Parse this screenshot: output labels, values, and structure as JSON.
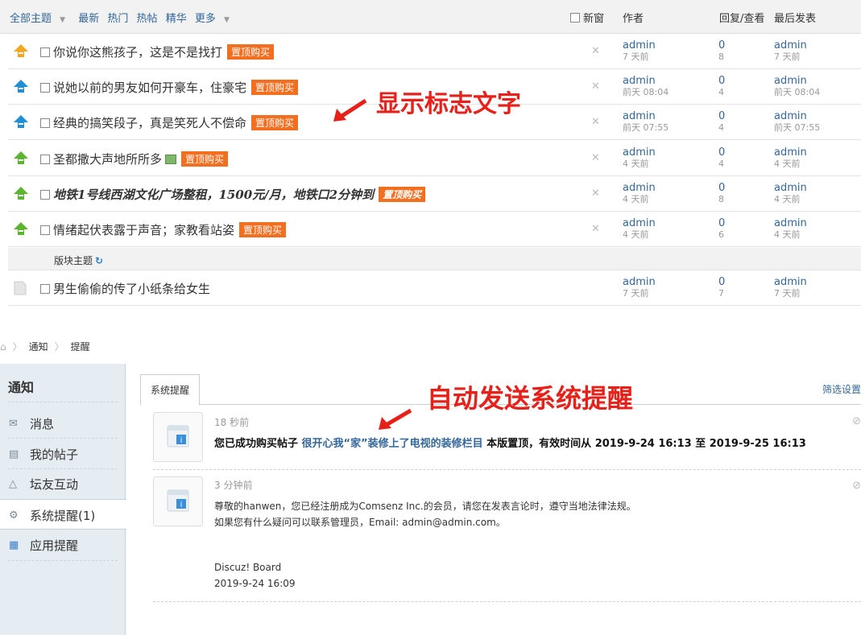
{
  "thread_header": {
    "tabs": [
      "全部主题",
      "最新",
      "热门",
      "热帖",
      "精华",
      "更多"
    ],
    "new_window": "新窗",
    "col_author": "作者",
    "col_reply_view": "回复/查看",
    "col_last_post": "最后发表"
  },
  "threads": [
    {
      "title": "你说你这熊孩子，这是不是找打",
      "badge": "置顶购买",
      "author": "admin",
      "author_time": "7 天前",
      "replies": "0",
      "views": "8",
      "last_user": "admin",
      "last_time": "7 天前",
      "icon": "pin-up-orange-icon"
    },
    {
      "title": "说她以前的男友如何开豪车，住豪宅",
      "badge": "置顶购买",
      "author": "admin",
      "author_time": "前天 08:04",
      "replies": "0",
      "views": "4",
      "last_user": "admin",
      "last_time": "前天 08:04",
      "icon": "pin-up-blue-icon"
    },
    {
      "title": "经典的搞笑段子，真是笑死人不偿命",
      "badge": "置顶购买",
      "author": "admin",
      "author_time": "前天 07:55",
      "replies": "0",
      "views": "4",
      "last_user": "admin",
      "last_time": "前天 07:55",
      "icon": "pin-up-blue-icon"
    },
    {
      "title": "圣都撒大声地所所多",
      "badge": "置顶购买",
      "author": "admin",
      "author_time": "4 天前",
      "replies": "0",
      "views": "4",
      "last_user": "admin",
      "last_time": "4 天前",
      "icon": "pin-up-green-icon"
    },
    {
      "title": "地铁1号线西湖文化广场整租，1500元/月，地铁口2分钟到",
      "badge": "置顶购买",
      "author": "admin",
      "author_time": "4 天前",
      "replies": "0",
      "views": "8",
      "last_user": "admin",
      "last_time": "4 天前",
      "icon": "pin-up-green-icon"
    },
    {
      "title": "情绪起伏表露于声音；家教看站姿",
      "badge": "置顶购买",
      "author": "admin",
      "author_time": "4 天前",
      "replies": "0",
      "views": "6",
      "last_user": "admin",
      "last_time": "4 天前",
      "icon": "pin-up-green-icon"
    }
  ],
  "section": {
    "label": "版块主题"
  },
  "normal_thread": {
    "title": "男生偷偷的传了小纸条给女生",
    "author": "admin",
    "author_time": "7 天前",
    "replies": "0",
    "views": "7",
    "last_user": "admin",
    "last_time": "7 天前"
  },
  "annotations": {
    "top": "显示标志文字",
    "bottom": "自动发送系统提醒"
  },
  "breadcrumb": {
    "item1": "通知",
    "item2": "提醒"
  },
  "sidebar": {
    "title": "通知",
    "items": [
      {
        "label": "消息",
        "icon": "mail-icon"
      },
      {
        "label": "我的帖子",
        "icon": "document-icon"
      },
      {
        "label": "坛友互动",
        "icon": "triangle-icon"
      },
      {
        "label": "系统提醒(1)",
        "icon": "gear-icon"
      },
      {
        "label": "应用提醒",
        "icon": "grid-icon"
      }
    ]
  },
  "tabs": {
    "active": "系统提醒",
    "filter": "筛选设置"
  },
  "notices": [
    {
      "time": "18 秒前",
      "prefix": "您已成功购买帖子",
      "link": "很开心我“家”装修上了电视的装修栏目",
      "suffix": "本版置顶，有效时间从 2019-9-24 16:13 至 2019-9-25 16:13"
    },
    {
      "time": "3 分钟前",
      "line1": "尊敬的hanwen，您已经注册成为Comsenz Inc.的会员，请您在发表言论时，遵守当地法律法规。",
      "line2": "如果您有什么疑问可以联系管理员，Email: admin@admin.com。",
      "sign1": "Discuz! Board",
      "sign2": "2019-9-24 16:09"
    }
  ],
  "colors": {
    "accent": "#336699",
    "badge": "#f36f20",
    "annotation": "#e8201a"
  }
}
